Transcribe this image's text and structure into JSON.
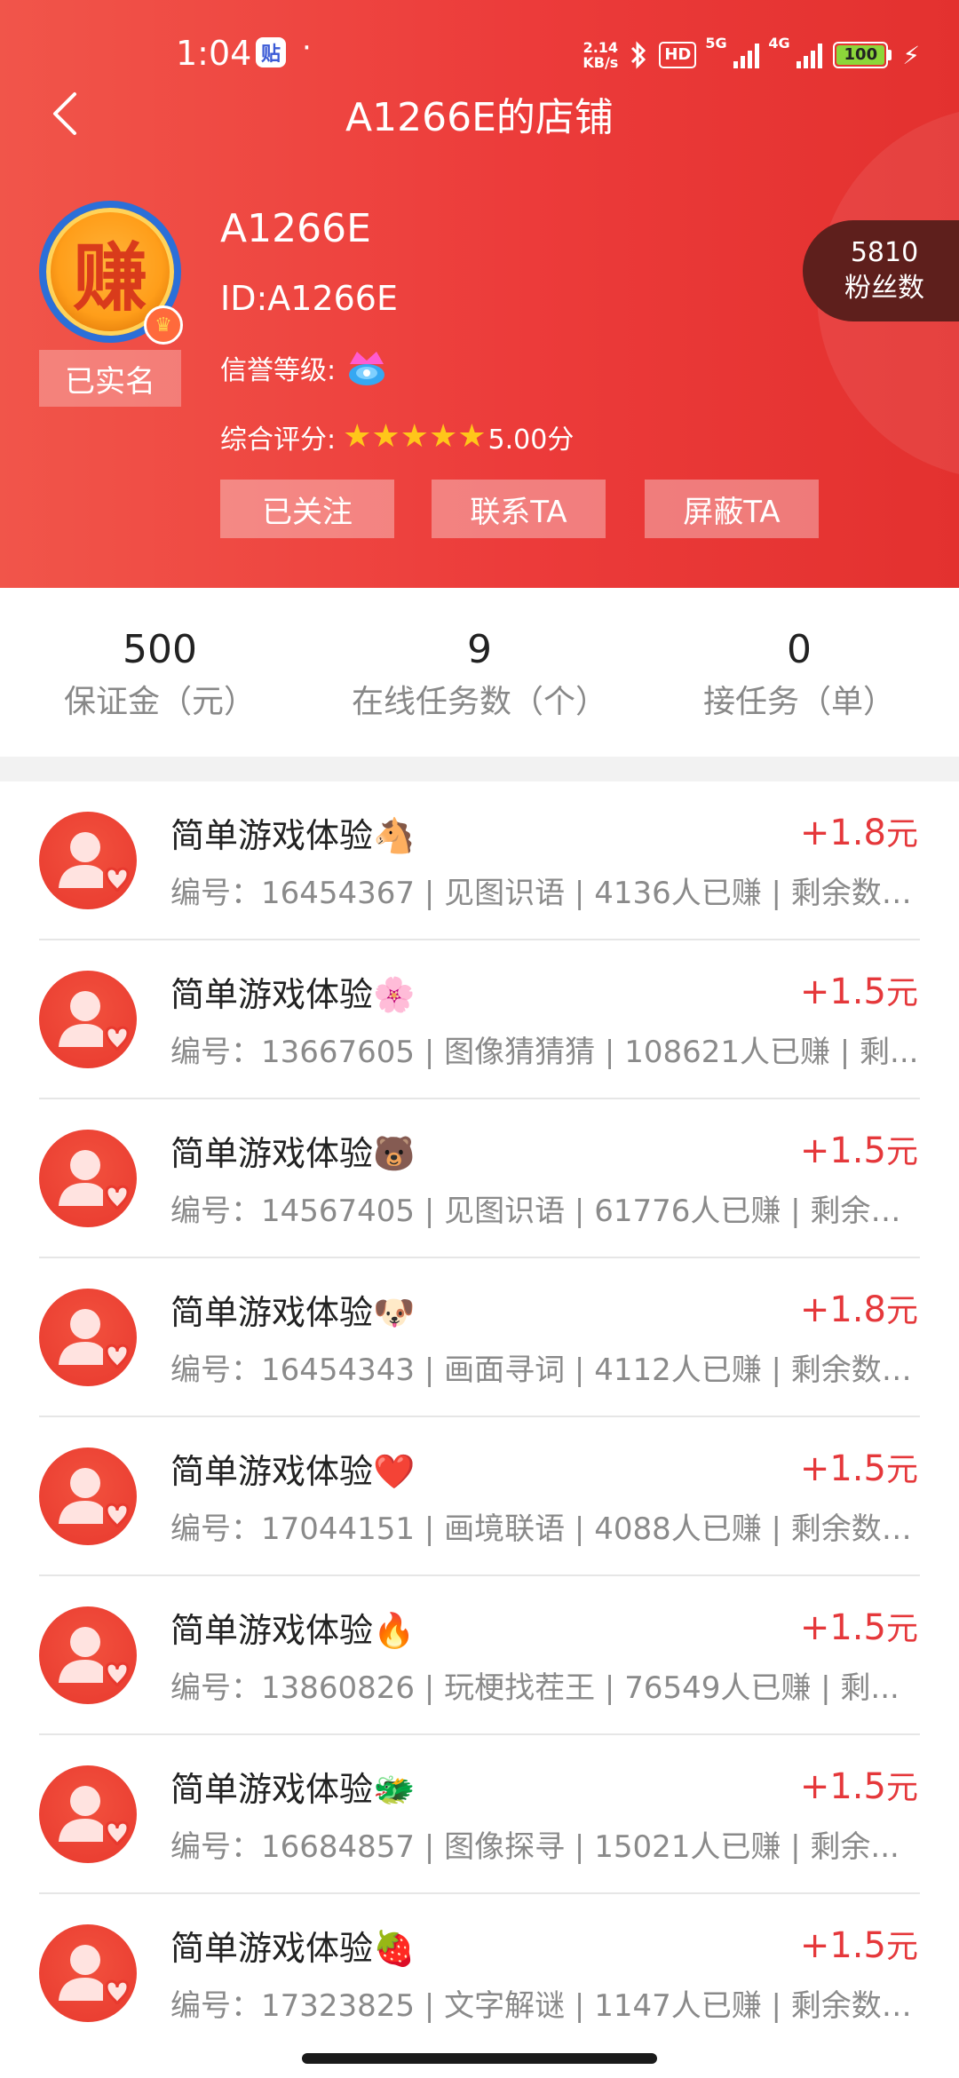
{
  "status_bar": {
    "time": "1:04",
    "app_icon_text": "贴",
    "dot": "·",
    "net_speed_top": "2.14",
    "net_speed_bottom": "KB/s",
    "hd_label": "HD",
    "signal1_label": "5G",
    "signal2_label": "4G",
    "battery": "100"
  },
  "nav": {
    "title": "A1266E的店铺"
  },
  "profile": {
    "avatar_char": "赚",
    "verified_label": "已实名",
    "name": "A1266E",
    "id_text": "ID:A1266E",
    "credit_label": "信誉等级:",
    "rating_label": "综合评分:",
    "stars": 5,
    "score": "5.00分",
    "fans_count": "5810",
    "fans_label": "粉丝数"
  },
  "actions": {
    "follow": "已关注",
    "contact": "联系TA",
    "block": "屏蔽TA"
  },
  "stats": [
    {
      "value": "500",
      "label": "保证金（元）"
    },
    {
      "value": "9",
      "label": "在线任务数（个）"
    },
    {
      "value": "0",
      "label": "接任务（单）"
    }
  ],
  "tasks": [
    {
      "title": "简单游戏体验🐴",
      "reward": "+1.8",
      "unit": "元",
      "meta": "编号：16454367 | 见图识语 | 4136人已赚 | 剩余数：..."
    },
    {
      "title": "简单游戏体验🌸",
      "reward": "+1.5",
      "unit": "元",
      "meta": "编号：13667605 | 图像猜猜猜 | 108621人已赚 | 剩..."
    },
    {
      "title": "简单游戏体验🐻",
      "reward": "+1.5",
      "unit": "元",
      "meta": "编号：14567405 | 见图识语 | 61776人已赚 | 剩余数..."
    },
    {
      "title": "简单游戏体验🐶",
      "reward": "+1.8",
      "unit": "元",
      "meta": "编号：16454343 | 画面寻词 | 4112人已赚 | 剩余数：..."
    },
    {
      "title": "简单游戏体验❤️",
      "reward": "+1.5",
      "unit": "元",
      "meta": "编号：17044151 | 画境联语 | 4088人已赚 | 剩余数：..."
    },
    {
      "title": "简单游戏体验🔥",
      "reward": "+1.5",
      "unit": "元",
      "meta": "编号：13860826 | 玩梗找茬王 | 76549人已赚 | 剩..."
    },
    {
      "title": "简单游戏体验🐲",
      "reward": "+1.5",
      "unit": "元",
      "meta": "编号：16684857 | 图像探寻 | 15021人已赚 | 剩余..."
    },
    {
      "title": "简单游戏体验🍓",
      "reward": "+1.5",
      "unit": "元",
      "meta": "编号：17323825 | 文字解谜 | 1147人已赚 | 剩余数：..."
    }
  ],
  "colors": {
    "header_red": "#ec3b3a",
    "reward_red": "#e5383b",
    "fans_pill": "#5e1f1c"
  }
}
